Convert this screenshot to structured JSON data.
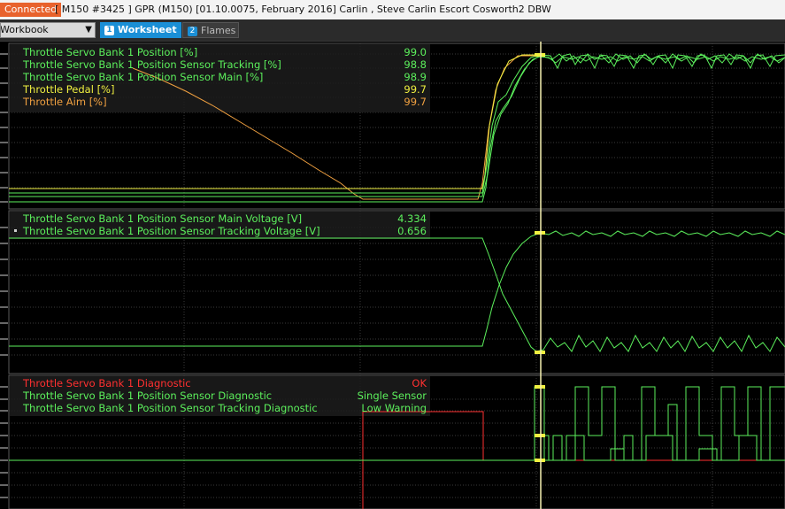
{
  "window": {
    "status": "Connected",
    "title": "[ M150 #3425 ]  GPR (M150) [01.10.0075, February 2016] Carlin , Steve Carlin Escort Cosworth2 DBW"
  },
  "toolbar": {
    "workbook_value": "Workbook",
    "tabs": [
      {
        "num": "1",
        "label": "Worksheet"
      },
      {
        "num": "2",
        "label": "Flames"
      }
    ]
  },
  "colors": {
    "green": "#5cf05c",
    "yellow": "#f0f040",
    "orange": "#f0a040",
    "red": "#ff3030",
    "cursor": "#f5f0b0"
  },
  "panels": [
    {
      "name": "throttle-position",
      "channels": [
        {
          "label": "Throttle Servo Bank 1 Position [%]",
          "value": "99.0",
          "color": "green"
        },
        {
          "label": "Throttle Servo Bank 1 Position Sensor Tracking [%]",
          "value": "98.8",
          "color": "green"
        },
        {
          "label": "Throttle Servo Bank 1 Position Sensor Main [%]",
          "value": "98.9",
          "color": "green"
        },
        {
          "label": "Throttle Pedal [%]",
          "value": "99.7",
          "color": "yellow"
        },
        {
          "label": "Throttle Aim [%]",
          "value": "99.7",
          "color": "orange"
        }
      ]
    },
    {
      "name": "sensor-voltage",
      "channels": [
        {
          "label": "Throttle Servo Bank 1 Position Sensor Main Voltage [V]",
          "value": "4.334",
          "color": "green"
        },
        {
          "label": "Throttle Servo Bank 1 Position Sensor Tracking Voltage [V]",
          "value": "0.656",
          "color": "green"
        }
      ]
    },
    {
      "name": "diagnostics",
      "channels": [
        {
          "label": "Throttle Servo Bank 1 Diagnostic",
          "value": "OK",
          "color": "red"
        },
        {
          "label": "Throttle Servo Bank 1 Position Sensor Diagnostic",
          "value": "Single Sensor",
          "color": "green"
        },
        {
          "label": "Throttle Servo Bank 1 Position Sensor Tracking Diagnostic",
          "value": "Low Warning",
          "color": "green"
        }
      ]
    }
  ]
}
